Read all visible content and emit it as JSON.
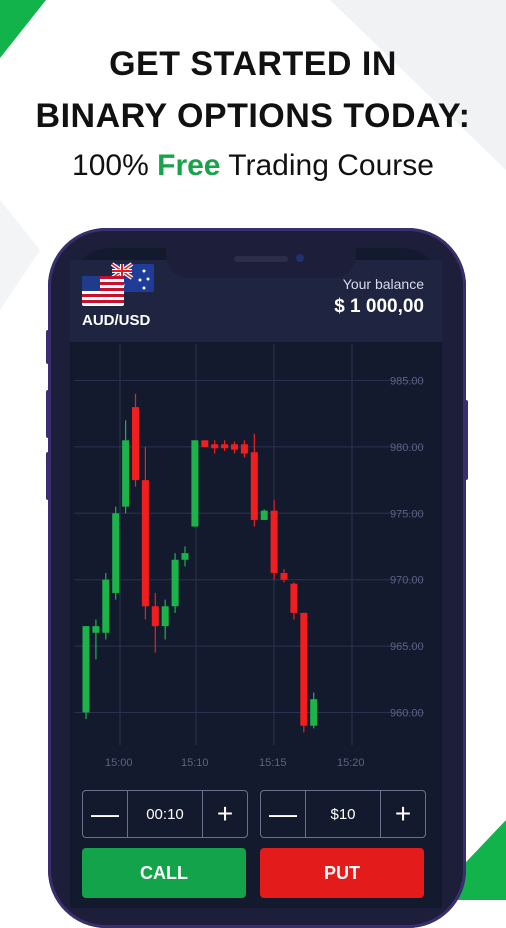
{
  "promo": {
    "headline_line1": "GET STARTED IN",
    "headline_line2": "BINARY OPTIONS TODAY:",
    "sub_prefix": "100% ",
    "sub_accent": "Free",
    "sub_suffix": " Trading Course"
  },
  "colors": {
    "accent_green": "#18a24a",
    "call_green": "#13a34a",
    "put_red": "#e31b1b",
    "candle_up": "#1bb34a",
    "candle_down": "#f01e1e"
  },
  "app": {
    "pair": "AUD/USD",
    "flags": [
      "us-flag-icon",
      "australia-flag-icon"
    ],
    "balance_label": "Your balance",
    "balance_value": "$ 1 000,00"
  },
  "chart_data": {
    "type": "candlestick",
    "y_ticks": [
      "985.00",
      "980.00",
      "975.00",
      "970.00",
      "965.00",
      "960.00"
    ],
    "x_ticks": [
      "15:00",
      "15:10",
      "15:15",
      "15:20"
    ],
    "ylim": [
      958,
      987
    ],
    "grid": true,
    "candles": [
      {
        "o": 960,
        "c": 966.5,
        "h": 966.5,
        "l": 959.5
      },
      {
        "o": 966,
        "c": 966.5,
        "h": 967,
        "l": 964
      },
      {
        "o": 966,
        "c": 970,
        "h": 970.5,
        "l": 965.5
      },
      {
        "o": 969,
        "c": 975,
        "h": 975.5,
        "l": 968.5
      },
      {
        "o": 975.5,
        "c": 980.5,
        "h": 982,
        "l": 975
      },
      {
        "o": 983,
        "c": 977.5,
        "h": 984,
        "l": 977
      },
      {
        "o": 977.5,
        "c": 968,
        "h": 980,
        "l": 967
      },
      {
        "o": 968,
        "c": 966.5,
        "h": 969,
        "l": 964.5
      },
      {
        "o": 966.5,
        "c": 968,
        "h": 968.5,
        "l": 965.5
      },
      {
        "o": 968,
        "c": 971.5,
        "h": 972,
        "l": 967.5
      },
      {
        "o": 971.5,
        "c": 972,
        "h": 972.5,
        "l": 971
      },
      {
        "o": 974,
        "c": 980.5,
        "h": 980.5,
        "l": 974
      },
      {
        "o": 980.5,
        "c": 980,
        "h": 980.5,
        "l": 980
      },
      {
        "o": 980.2,
        "c": 980,
        "h": 980.5,
        "l": 979.5
      },
      {
        "o": 980.2,
        "c": 980,
        "h": 980.5,
        "l": 979.7
      },
      {
        "o": 980.2,
        "c": 979.8,
        "h": 980.4,
        "l": 979.5
      },
      {
        "o": 980.2,
        "c": 979.5,
        "h": 980.5,
        "l": 979.2
      },
      {
        "o": 979.6,
        "c": 974.5,
        "h": 981,
        "l": 974
      },
      {
        "o": 974.5,
        "c": 975.2,
        "h": 975.3,
        "l": 974.5
      },
      {
        "o": 975.2,
        "c": 970.5,
        "h": 976,
        "l": 970
      },
      {
        "o": 970.5,
        "c": 970,
        "h": 970.8,
        "l": 969.8
      },
      {
        "o": 969.7,
        "c": 967.5,
        "h": 969.8,
        "l": 967
      },
      {
        "o": 967.5,
        "c": 959,
        "h": 967.5,
        "l": 958.5
      },
      {
        "o": 959,
        "c": 961,
        "h": 961.5,
        "l": 958.8
      }
    ]
  },
  "controls": {
    "time_value": "00:10",
    "amount_value": "$10",
    "minus_symbol": "—",
    "plus_symbol": "+",
    "call_label": "CALL",
    "put_label": "PUT"
  }
}
